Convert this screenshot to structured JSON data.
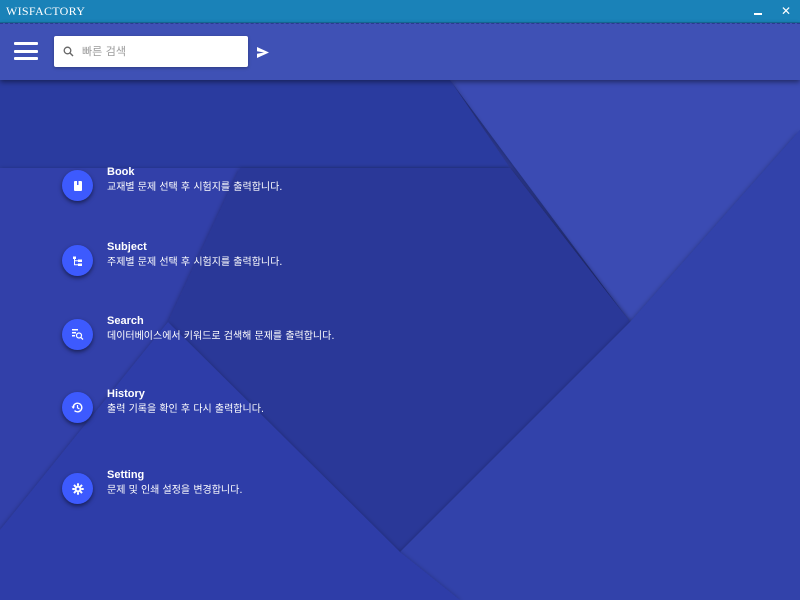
{
  "window": {
    "title": "WISFACTORY",
    "minimize_label": "_",
    "close_label": "✕"
  },
  "appbar": {
    "menu_icon": "hamburger-menu-icon",
    "search": {
      "placeholder": "빠른 검색",
      "value": ""
    },
    "send_icon": "send-icon"
  },
  "colors": {
    "titlebar": "#1a82b8",
    "appbar": "#3f51b5",
    "background": "#2f3da6",
    "icon_circle": "#3d5afe"
  },
  "menu": {
    "items": [
      {
        "title": "Book",
        "description": "교재별 문제 선택 후 시험지를 출력합니다.",
        "icon": "book-icon"
      },
      {
        "title": "Subject",
        "description": "주제별 문제 선택 후 시험지를 출력합니다.",
        "icon": "subject-tree-icon"
      },
      {
        "title": "Search",
        "description": "데이터베이스에서 키워드로 검색해 문제를 출력합니다.",
        "icon": "search-database-icon"
      },
      {
        "title": "History",
        "description": "출력 기록을 확인 후 다시 출력합니다.",
        "icon": "history-icon"
      },
      {
        "title": "Setting",
        "description": "문제 및 인쇄 설정을 변경합니다.",
        "icon": "gear-icon"
      }
    ]
  }
}
